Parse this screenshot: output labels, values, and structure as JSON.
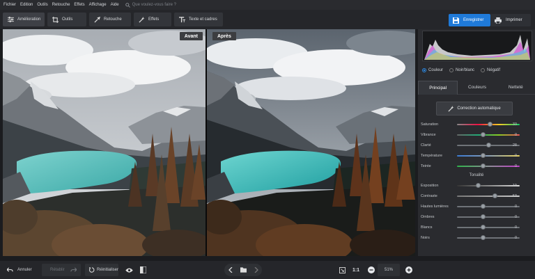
{
  "menu": {
    "items": [
      "Fichier",
      "Edition",
      "Outils",
      "Retouche",
      "Effets",
      "Affichage",
      "Aide"
    ],
    "search_placeholder": "Que voulez-vous faire ?"
  },
  "toolbar": {
    "tabs": [
      "Amélioration",
      "Outils",
      "Retouche",
      "Effets",
      "Texte et cadres"
    ],
    "save_label": "Enregistrer",
    "print_label": "Imprimer"
  },
  "viewer": {
    "before_label": "Avant",
    "after_label": "Après"
  },
  "panel": {
    "modes": [
      "Couleur",
      "Noir/blanc",
      "Négatif"
    ],
    "subtabs": [
      "Principal",
      "Couleurs",
      "Netteté"
    ],
    "auto_label": "Correction automatique",
    "tonalite_label": "Tonalité",
    "sliders": [
      {
        "label": "Saturation",
        "value": "33"
      },
      {
        "label": "Vibrance",
        "value": "0"
      },
      {
        "label": "Clarté",
        "value": "28"
      },
      {
        "label": "Température",
        "value": "0"
      },
      {
        "label": "Teinte",
        "value": "0"
      }
    ],
    "tone_sliders": [
      {
        "label": "Exposition",
        "value": "-19"
      },
      {
        "label": "Contraste",
        "value": "53"
      },
      {
        "label": "Hautes lumières",
        "value": "0"
      },
      {
        "label": "Ombres",
        "value": "0"
      },
      {
        "label": "Blancs",
        "value": "0"
      },
      {
        "label": "Noirs",
        "value": "0"
      }
    ]
  },
  "bottom": {
    "undo_label": "Annuler",
    "redo_label": "Rétablir",
    "reset_label": "Réinitialiser",
    "ratio_label": "1:1",
    "zoom_value": "51%"
  },
  "colors": {
    "accent": "#1f7ad9",
    "lake": "#3fb7b4"
  }
}
